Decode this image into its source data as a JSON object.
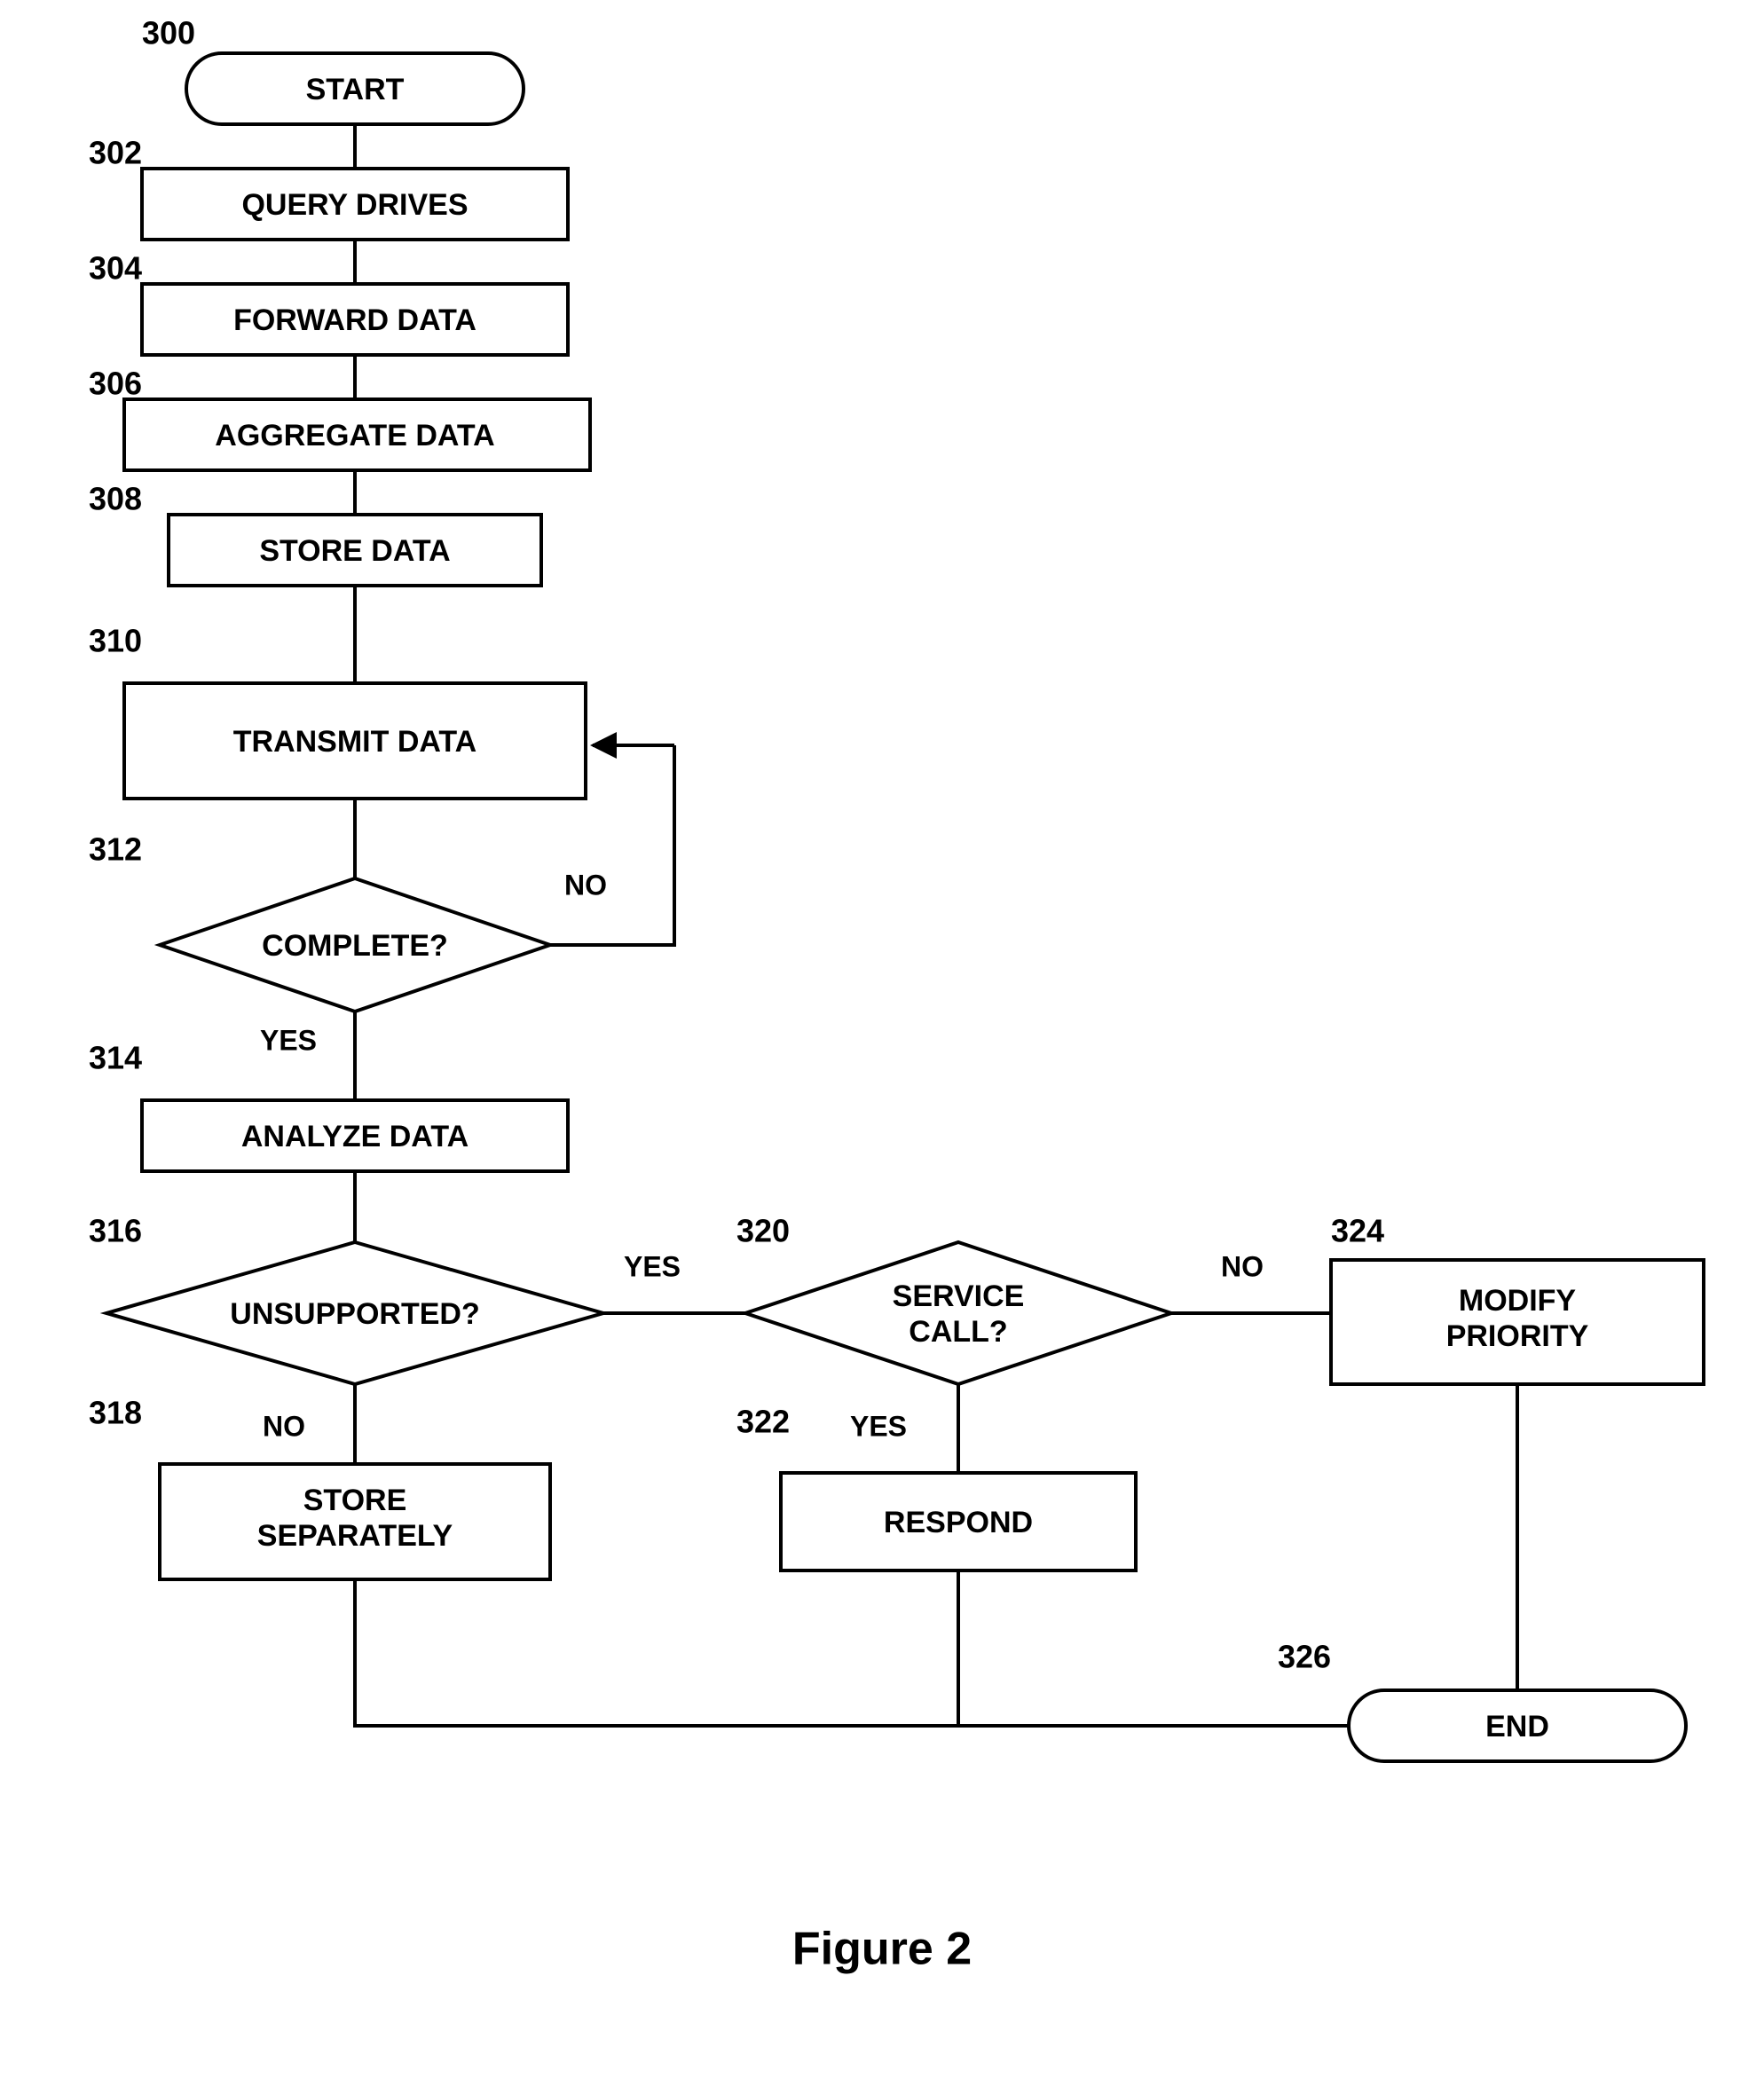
{
  "caption": "Figure 2",
  "nodes": {
    "start": {
      "ref": "300",
      "label": "START"
    },
    "query_drives": {
      "ref": "302",
      "label": "QUERY DRIVES"
    },
    "forward_data": {
      "ref": "304",
      "label": "FORWARD DATA"
    },
    "aggregate_data": {
      "ref": "306",
      "label": "AGGREGATE DATA"
    },
    "store_data": {
      "ref": "308",
      "label": "STORE DATA"
    },
    "transmit_data": {
      "ref": "310",
      "label": "TRANSMIT DATA"
    },
    "complete": {
      "ref": "312",
      "label": "COMPLETE?"
    },
    "analyze_data": {
      "ref": "314",
      "label": "ANALYZE DATA"
    },
    "unsupported": {
      "ref": "316",
      "label": "UNSUPPORTED?"
    },
    "store_separately": {
      "ref": "318",
      "label_a": "STORE",
      "label_b": "SEPARATELY"
    },
    "service_call": {
      "ref": "320",
      "label_a": "SERVICE",
      "label_b": "CALL?"
    },
    "respond": {
      "ref": "322",
      "label": "RESPOND"
    },
    "modify_priority": {
      "ref": "324",
      "label_a": "MODIFY",
      "label_b": "PRIORITY"
    },
    "end": {
      "ref": "326",
      "label": "END"
    }
  },
  "edges": {
    "yes": "YES",
    "no": "NO"
  }
}
